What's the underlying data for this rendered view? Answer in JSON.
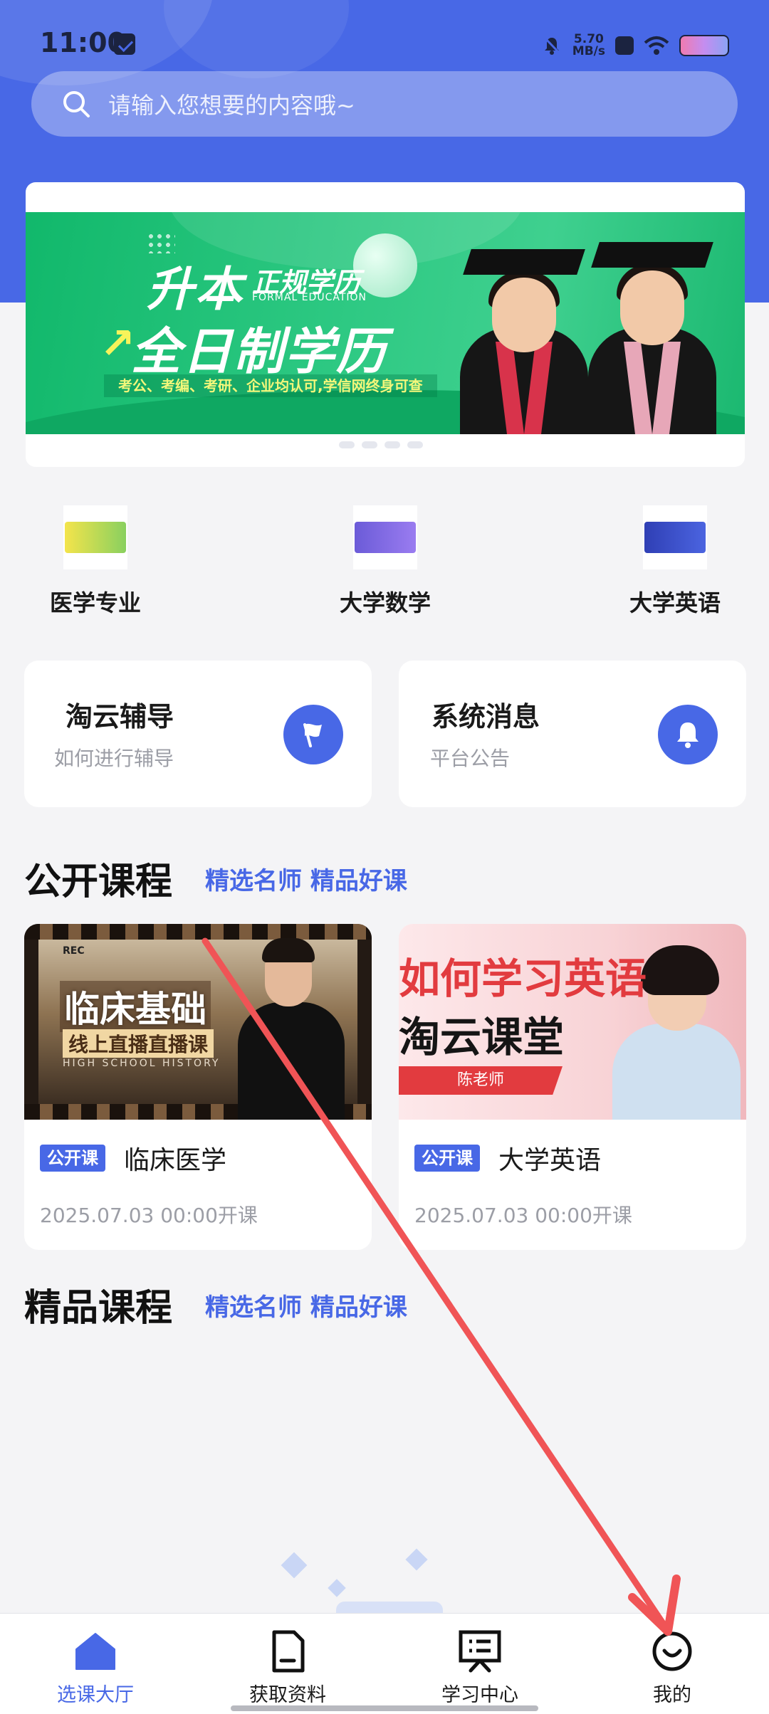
{
  "status_bar": {
    "time": "11:00",
    "net_speed_value": "5.70",
    "net_speed_unit": "MB/s"
  },
  "search": {
    "placeholder": "请输入您想要的内容哦~"
  },
  "banner": {
    "title_line1_a": "升本",
    "title_line1_b": "正规学历",
    "subtitle_en": "FORMAL EDUCATION",
    "title_line2": "全日制学历",
    "note": "考公、考编、考研、企业均认可,学信网终身可查"
  },
  "categories": [
    {
      "label": "医学专业",
      "icon": "medical-thumbnail-icon",
      "color": "#f4e44b"
    },
    {
      "label": "大学数学",
      "icon": "math-thumbnail-icon",
      "color": "#6b5bd8"
    },
    {
      "label": "大学英语",
      "icon": "english-thumbnail-icon",
      "color": "#2f3fb5"
    }
  ],
  "info_cards": [
    {
      "title": "淘云辅导",
      "subtitle": "如何进行辅导",
      "icon": "flag-icon"
    },
    {
      "title": "系统消息",
      "subtitle": "平台公告",
      "icon": "bell-icon"
    }
  ],
  "public_courses": {
    "title": "公开课程",
    "tag": "精选名师 精品好课",
    "items": [
      {
        "badge": "公开课",
        "name": "临床医学",
        "time": "2025.07.03 00:00开课",
        "cover": {
          "rec": "REC",
          "line1": "临床基础",
          "line2": "线上直播直播课",
          "line3": "HIGH SCHOOL HISTORY"
        }
      },
      {
        "badge": "公开课",
        "name": "大学英语",
        "time": "2025.07.03 00:00开课",
        "cover": {
          "line1": "如何学习英语",
          "line2": "淘云课堂",
          "teacher": "陈老师"
        }
      }
    ]
  },
  "premium_courses": {
    "title": "精品课程",
    "tag": "精选名师 精品好课"
  },
  "tab_bar": {
    "items": [
      {
        "label": "选课大厅",
        "icon": "home-icon",
        "active": true
      },
      {
        "label": "获取资料",
        "icon": "document-icon",
        "active": false
      },
      {
        "label": "学习中心",
        "icon": "study-board-icon",
        "active": false
      },
      {
        "label": "我的",
        "icon": "profile-smile-icon",
        "active": false
      }
    ]
  },
  "colors": {
    "primary": "#4868e6",
    "background": "#f4f4f6",
    "annotation_arrow": "#f05456"
  }
}
